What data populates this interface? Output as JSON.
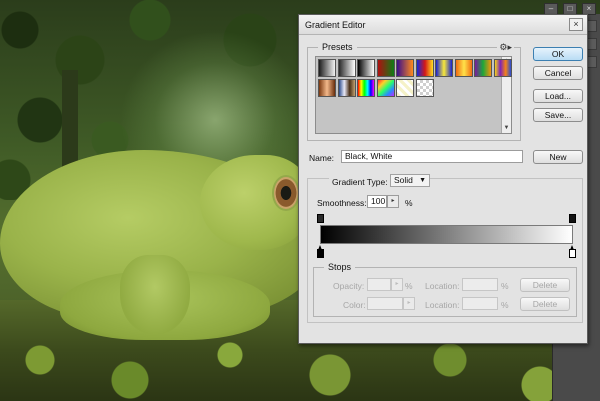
{
  "dialog": {
    "title": "Gradient Editor",
    "close_glyph": "×"
  },
  "presets": {
    "label": "Presets",
    "gear_glyph": "⚙▸",
    "swatches": [
      {
        "name": "foreground-to-background",
        "colors": [
          "#1d1d1d",
          "#f2f2f2"
        ]
      },
      {
        "name": "foreground-to-transparent",
        "colors": [
          "#2a2a2a",
          "#ffffff"
        ]
      },
      {
        "name": "black-white",
        "colors": [
          "#000000",
          "#ffffff"
        ]
      },
      {
        "name": "red-green",
        "colors": [
          "#b01010",
          "#0d7d16"
        ]
      },
      {
        "name": "violet-orange",
        "colors": [
          "#3a0e8c",
          "#ff8a1c"
        ]
      },
      {
        "name": "blue-red-yellow",
        "colors": [
          "#1728d8",
          "#d41818",
          "#ffe020"
        ]
      },
      {
        "name": "blue-yellow-blue",
        "colors": [
          "#1822d0",
          "#f7e83a",
          "#1822d0"
        ]
      },
      {
        "name": "orange-yellow-orange",
        "colors": [
          "#f06a10",
          "#ffe24a",
          "#f06a10"
        ]
      },
      {
        "name": "violet-green-orange",
        "colors": [
          "#7a1a9e",
          "#1ca83a",
          "#f2940e"
        ]
      },
      {
        "name": "yellow-violet-orange-blue",
        "colors": [
          "#f5d31a",
          "#7d23b8",
          "#f58218",
          "#2a4dd4"
        ]
      },
      {
        "name": "copper",
        "colors": [
          "#7a3810",
          "#f3b88a",
          "#6a2e0c"
        ]
      },
      {
        "name": "chrome",
        "colors": [
          "#2a4a8a",
          "#e8e8f8",
          "#4a3018",
          "#c0a070"
        ]
      },
      {
        "name": "spectrum",
        "colors": [
          "#ff0000",
          "#ffff00",
          "#00ff00",
          "#00ffff",
          "#0000ff",
          "#ff00ff"
        ]
      },
      {
        "name": "transparent-rainbow",
        "colors": [
          "#ff2a2a",
          "#ffd02a",
          "#2aff6a",
          "#2a8aff",
          "#c02aff"
        ]
      },
      {
        "name": "transparent-stripes",
        "colors": [
          "#f5f2c8",
          "#ffffff",
          "#f5f2c8"
        ]
      },
      {
        "name": "checker-transparent",
        "colors": [
          "#dddddd",
          "#ffffff"
        ]
      }
    ]
  },
  "buttons": {
    "ok": "OK",
    "cancel": "Cancel",
    "load": "Load...",
    "save": "Save...",
    "new": "New",
    "delete_opacity": "Delete",
    "delete_color": "Delete"
  },
  "name_field": {
    "label": "Name:",
    "value": "Black, White"
  },
  "gradient": {
    "type_label": "Gradient Type:",
    "type_value": "Solid",
    "smoothness_label": "Smoothness:",
    "smoothness_value": "100",
    "smoothness_unit": "%",
    "start_color": "#000000",
    "end_color": "#ffffff"
  },
  "stops": {
    "label": "Stops",
    "opacity_label": "Opacity:",
    "opacity_unit": "%",
    "location_label": "Location:",
    "location_unit": "%",
    "color_label": "Color:",
    "color_location_label": "Location:",
    "color_location_unit": "%"
  },
  "app_controls": [
    "–",
    "□",
    "×"
  ]
}
